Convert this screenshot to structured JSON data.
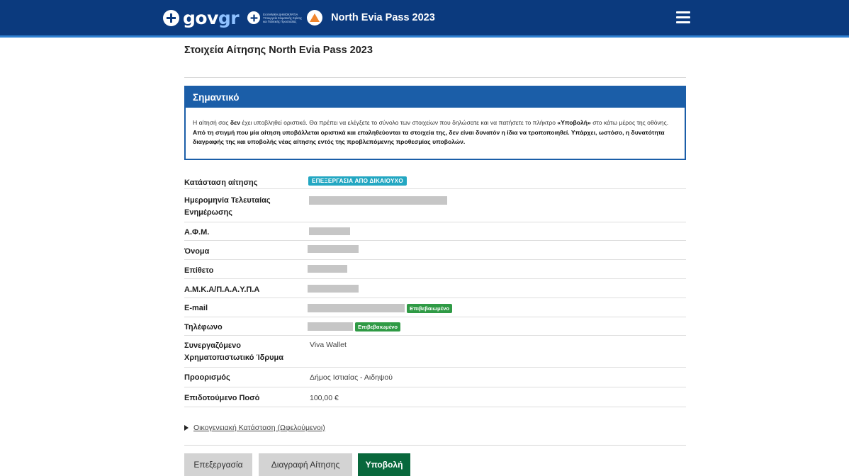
{
  "header": {
    "logo_text_gov": "gov",
    "logo_text_gr": "gr",
    "ministry_text": "ΕΛΛΗΝΙΚΗ ΔΗΜΟΚΡΑΤΙΑ Υπουργείο Κλιματικής Κρίσης και Πολιτικής Προστασίας",
    "app_title": "North Evia Pass 2023",
    "menu_icon": "hamburger-menu-icon",
    "colors": {
      "bar": "#0b3a7e",
      "accent": "#2f80d1"
    }
  },
  "page": {
    "title": "Στοιχεία Αίτησης North Evia Pass 2023"
  },
  "notice": {
    "heading": "Σημαντικό",
    "text_1": "Η αίτησή σας ",
    "text_bold_1": "δεν",
    "text_2": " έχει υποβληθεί οριστικά. Θα πρέπει να ελέγξετε το σύνολο των στοιχείων που δηλώσατε και να πατήσετε το πλήκτρο ",
    "text_bold_2": "«Υποβολή»",
    "text_3": " στο κάτω μέρος της οθόνης. ",
    "text_bold_3": "Από τη στιγμή που μία αίτηση υποβάλλεται οριστικά και επαληθεύονται τα στοιχεία της, δεν είναι δυνατόν η ίδια να τροποποιηθεί. Υπάρχει, ωστόσο, η δυνατότητα διαγραφής της και υποβολής νέας αίτησης εντός της προβλεπόμενης προθεσμίας υποβολών.",
    "color": "#1b5ea8"
  },
  "details": {
    "status_label": "Κατάσταση αίτησης",
    "status_value": "ΕΠΕΞΕΡΓΑΣΙΑ ΑΠΟ ΔΙΚΑΙΟΥΧΟ",
    "last_update_label": "Ημερομηνία Τελευταίας Ενημέρωσης",
    "afm_label": "Α.Φ.Μ.",
    "name_label": "Όνομα",
    "surname_label": "Επίθετο",
    "amka_label": "Α.Μ.Κ.Α/Π.Α.Α.Υ.Π.Α",
    "email_label": "E-mail",
    "email_badge": "Επιβεβαιωμένο",
    "phone_label": "Τηλέφωνο",
    "phone_badge": "Επιβεβαιωμένο",
    "institution_label": "Συνεργαζόμενο Χρηματοπιστωτικό Ίδρυμα",
    "institution_value": "Viva Wallet",
    "destination_label": "Προορισμός",
    "destination_value": "Δήμος Ιστιαίας - Αιδηψού",
    "amount_label": "Επιδοτούμενο Ποσό",
    "amount_value": "100,00 €",
    "colors": {
      "status_badge": "#23a7c2",
      "verified_badge": "#2f9a45"
    }
  },
  "family": {
    "link_text": "Οικογενειακή Κατάσταση (Ωφελούμενοι)"
  },
  "actions": {
    "edit_label": "Επεξεργασία",
    "delete_label": "Διαγραφή Αίτησης",
    "submit_label": "Υποβολή",
    "submit_color": "#08683c"
  }
}
